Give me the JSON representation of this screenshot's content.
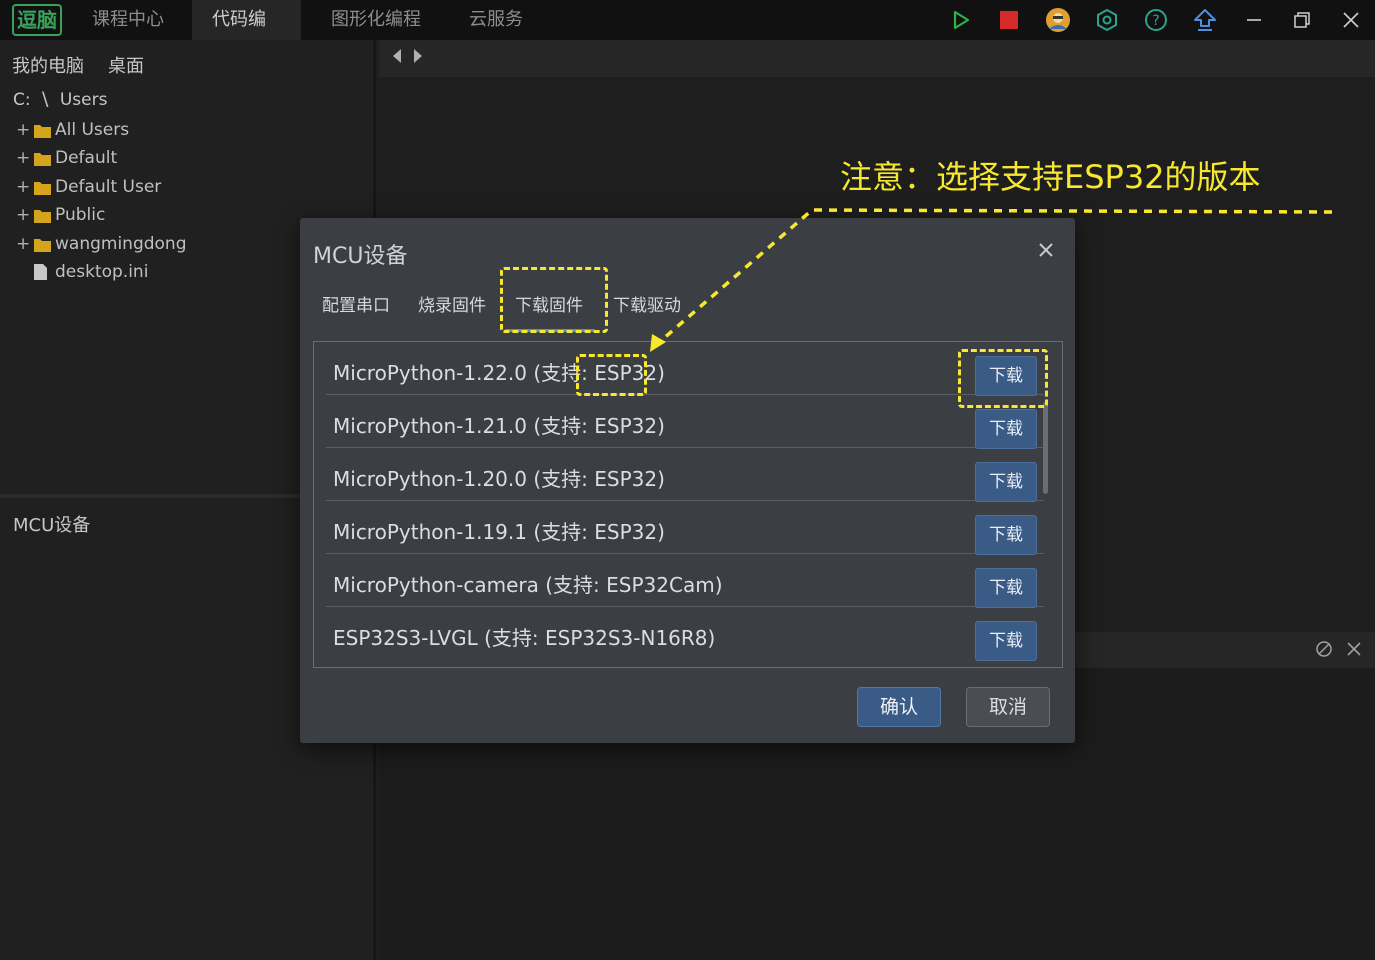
{
  "app": {
    "logo_text": "逗脑",
    "menu": [
      "课程中心",
      "代码编程",
      "图形化编程",
      "云服务"
    ],
    "active_menu_index": 1
  },
  "toolbar_icons": [
    "run-icon",
    "stop-icon",
    "user-avatar-icon",
    "settings-hex-icon",
    "help-icon",
    "upload-icon"
  ],
  "window_controls": [
    "minimize-icon",
    "restore-icon",
    "close-icon"
  ],
  "left_panel": {
    "tabs": [
      "我的电脑",
      "桌面"
    ],
    "path": {
      "drive": "C:",
      "sep": "\\",
      "folder": "Users"
    },
    "tree": [
      {
        "name": "All Users",
        "type": "folder"
      },
      {
        "name": "Default",
        "type": "folder"
      },
      {
        "name": "Default User",
        "type": "folder"
      },
      {
        "name": "Public",
        "type": "folder"
      },
      {
        "name": "wangmingdong",
        "type": "folder"
      },
      {
        "name": "desktop.ini",
        "type": "file"
      }
    ],
    "section_label": "MCU设备"
  },
  "annotation": {
    "text": "注意：选择支持ESP32的版本",
    "color": "#f7e82f"
  },
  "dialog": {
    "title": "MCU设备",
    "tabs": [
      "配置串口",
      "烧录固件",
      "下载固件",
      "下载驱动"
    ],
    "active_tab_index": 2,
    "firmware_list": [
      {
        "name": "MicroPython-1.22.0 (支持: ESP32)",
        "button": "下载"
      },
      {
        "name": "MicroPython-1.21.0 (支持: ESP32)",
        "button": "下载"
      },
      {
        "name": "MicroPython-1.20.0 (支持: ESP32)",
        "button": "下载"
      },
      {
        "name": "MicroPython-1.19.1 (支持: ESP32)",
        "button": "下载"
      },
      {
        "name": "MicroPython-camera (支持: ESP32Cam)",
        "button": "下载"
      },
      {
        "name": "ESP32S3-LVGL (支持: ESP32S3-N16R8)",
        "button": "下载"
      }
    ],
    "ok_label": "确认",
    "cancel_label": "取消"
  },
  "colors": {
    "accent": "#3a5b85",
    "tab_underline": "#4f8fd8",
    "run": "#2fb14a",
    "stop": "#d42a2a",
    "icon_teal": "#2aa58a"
  }
}
